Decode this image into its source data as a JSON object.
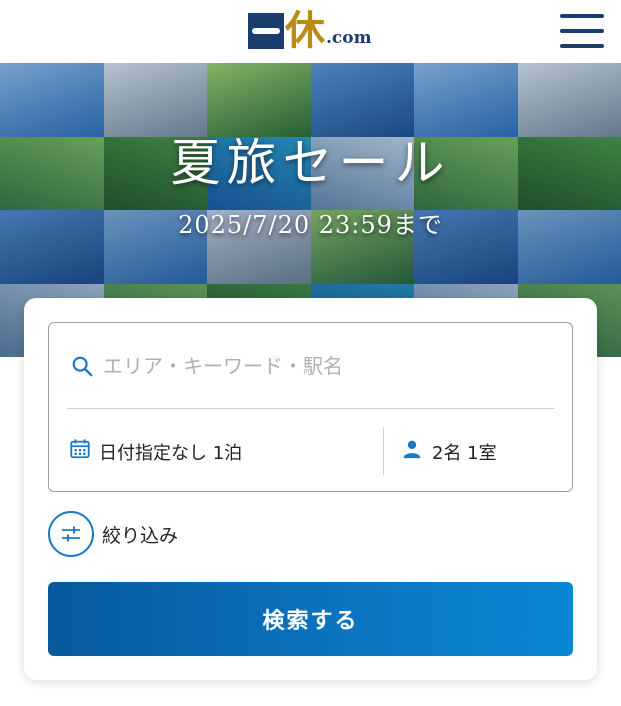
{
  "header": {
    "logo_kanji": "休",
    "logo_suffix": ".com"
  },
  "banner": {
    "title": "夏旅セール",
    "deadline": "2025/7/20 23:59まで"
  },
  "search": {
    "keyword_placeholder": "エリア・キーワード・駅名",
    "date_label": "日付指定なし 1泊",
    "guests_label": "2名 1室",
    "filter_label": "絞り込み",
    "submit_label": "検索する"
  },
  "colors": {
    "brand_navy": "#1b3d6e",
    "brand_gold": "#b98a14",
    "accent_blue": "#1a7bc4",
    "button_gradient_start": "#07599c",
    "button_gradient_end": "#0a86d4"
  },
  "icons": {
    "menu": "hamburger-menu-icon",
    "keyword": "search-icon",
    "date": "calendar-icon",
    "guests": "person-icon",
    "filter": "sliders-icon"
  }
}
